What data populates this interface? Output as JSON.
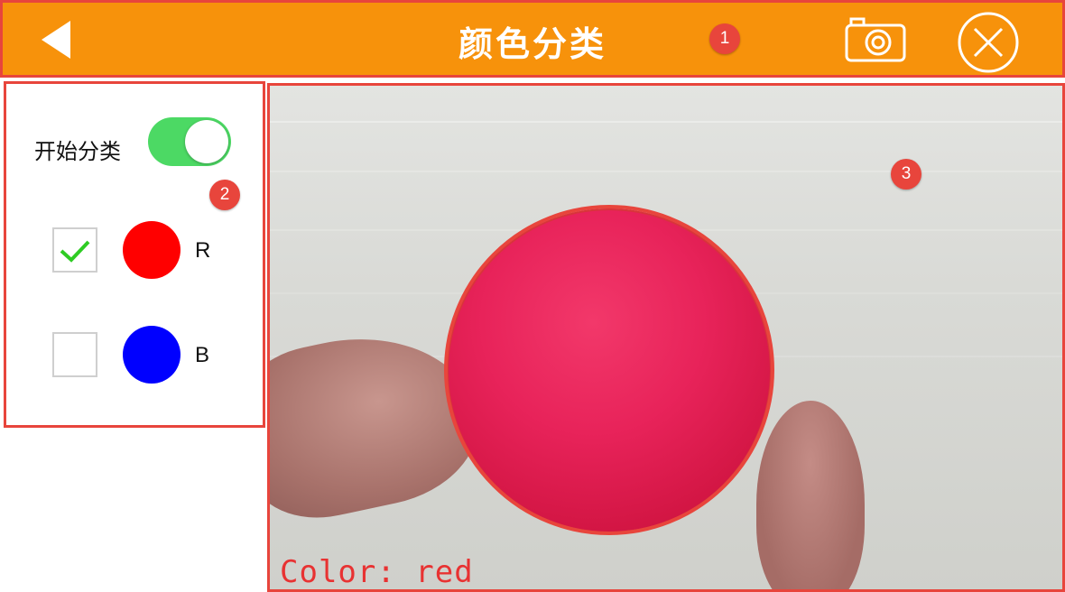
{
  "header": {
    "title": "颜色分类",
    "back_icon": "back-arrow-icon",
    "camera_icon": "camera-icon",
    "close_icon": "close-icon",
    "background_color": "#f7920b"
  },
  "annotations": [
    "1",
    "2",
    "3"
  ],
  "panel": {
    "toggle_label": "开始分类",
    "toggle_on": true,
    "colors": [
      {
        "letter": "R",
        "checked": true,
        "swatch": "#ff0000"
      },
      {
        "letter": "B",
        "checked": false,
        "swatch": "#0000ff"
      }
    ]
  },
  "camera": {
    "detected_text": "Color: red",
    "text_color": "#e83232"
  }
}
